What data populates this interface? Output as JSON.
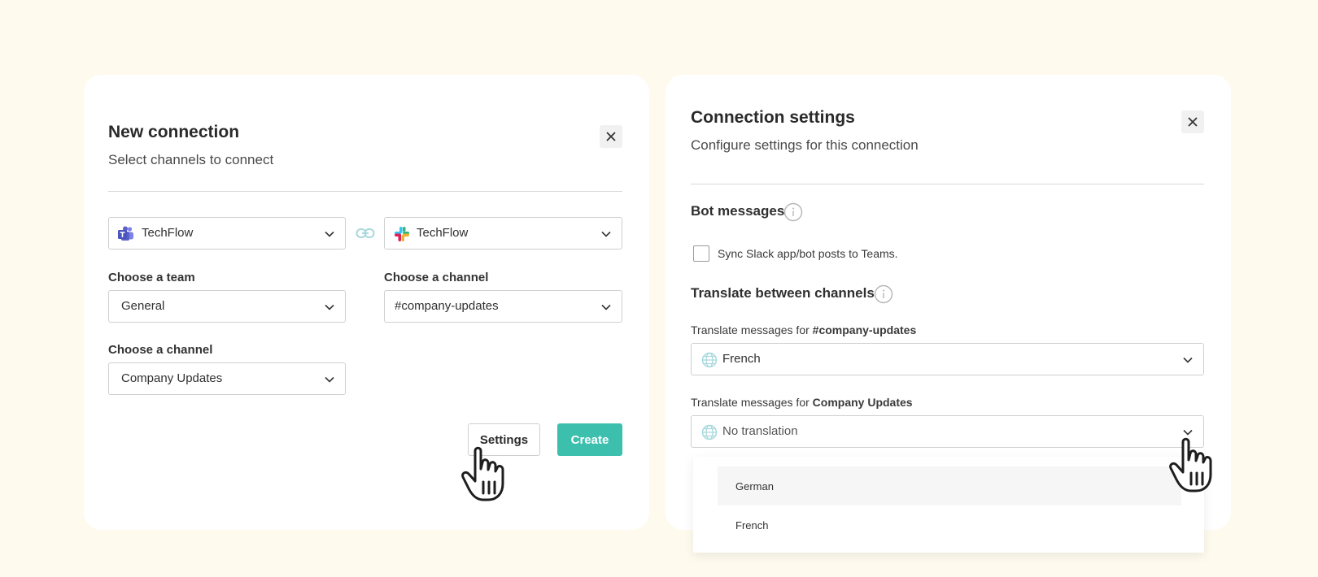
{
  "left_panel": {
    "title": "New connection",
    "subtitle": "Select channels to connect",
    "teams_workspace": "TechFlow",
    "slack_workspace": "TechFlow",
    "team_label": "Choose a team",
    "team_value": "General",
    "slack_channel_label": "Choose a channel",
    "slack_channel_value": "#company-updates",
    "teams_channel_label": "Choose a channel",
    "teams_channel_value": "Company Updates",
    "settings_button": "Settings",
    "create_button": "Create"
  },
  "right_panel": {
    "title": "Connection settings",
    "subtitle": "Configure settings for this connection",
    "bot_section": "Bot messages",
    "bot_checkbox_label": "Sync Slack app/bot posts to Teams.",
    "bot_checkbox_checked": false,
    "translate_section": "Translate between channels",
    "translate1_prefix": "Translate messages for ",
    "translate1_channel": "#company-updates",
    "translate1_value": "French",
    "translate2_prefix": "Translate messages for ",
    "translate2_channel": "Company Updates",
    "translate2_value": "No translation",
    "dropdown_options": [
      "German",
      "French"
    ]
  },
  "colors": {
    "background": "#fefbee",
    "primary": "#3dbfae",
    "teams": "#5b5fc7",
    "link": "#a8d8dc"
  },
  "icons": {
    "close": "close-icon",
    "chevron": "chevron-down-icon",
    "teams": "teams-logo-icon",
    "slack": "slack-logo-icon",
    "link": "link-icon",
    "info": "info-icon",
    "globe": "globe-icon",
    "cursor": "hand-pointer-icon"
  }
}
